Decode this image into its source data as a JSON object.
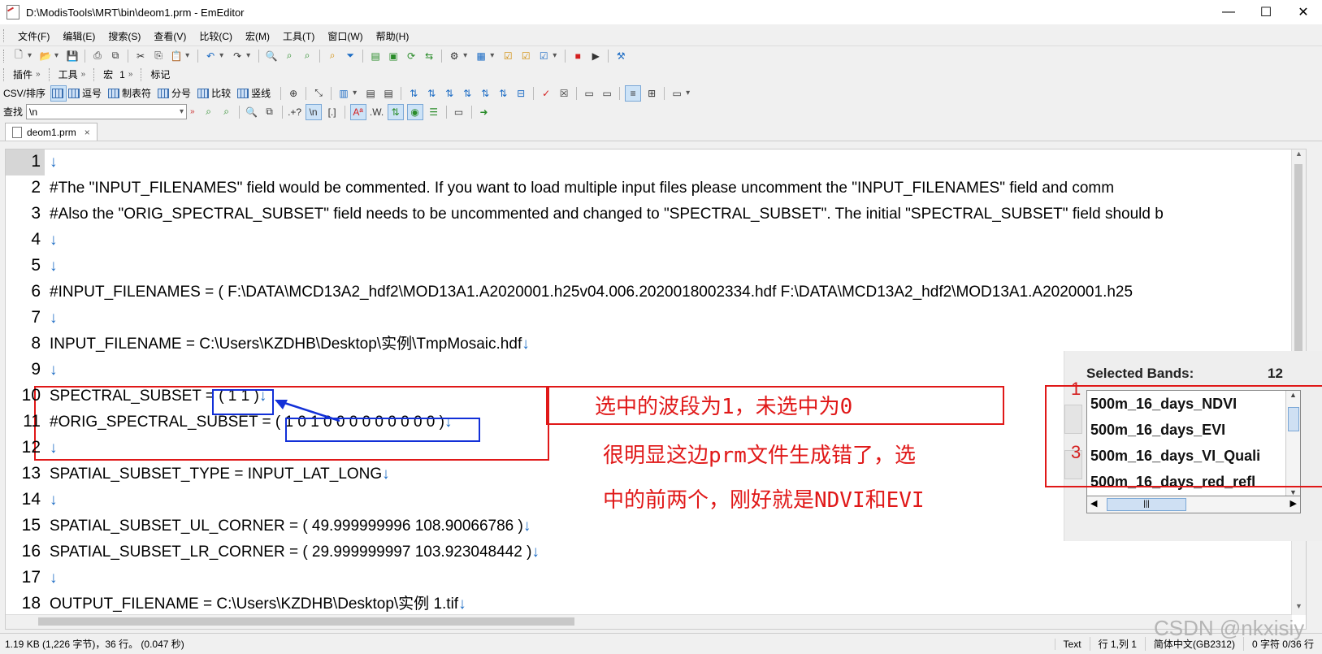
{
  "window": {
    "title": "D:\\ModisTools\\MRT\\bin\\deom1.prm - EmEditor",
    "minimize": "—",
    "maximize": "☐",
    "close": "✕"
  },
  "menu": [
    "文件(F)",
    "编辑(E)",
    "搜索(S)",
    "查看(V)",
    "比较(C)",
    "宏(M)",
    "工具(T)",
    "窗口(W)",
    "帮助(H)"
  ],
  "bars": {
    "plugins": "插件",
    "tools": "工具",
    "macro": "宏",
    "macro_num": "1",
    "marks": "标记"
  },
  "csv": {
    "label": "CSV/排序",
    "items": [
      "逗号",
      "制表符",
      "分号",
      "比较",
      "竖线"
    ]
  },
  "find": {
    "label": "查找",
    "value": "\\n",
    "regex": "\\n",
    "bracket": "[.]"
  },
  "tab": {
    "label": "deom1.prm"
  },
  "editor": {
    "lines": [
      {
        "n": "1",
        "text": "",
        "eol": "↓"
      },
      {
        "n": "2",
        "text": "#The \"INPUT_FILENAMES\" field would be commented. If you want to load multiple input files please uncomment the \"INPUT_FILENAMES\" field and comm",
        "eol": ""
      },
      {
        "n": "3",
        "text": "#Also the \"ORIG_SPECTRAL_SUBSET\" field needs to be uncommented and changed to \"SPECTRAL_SUBSET\". The initial \"SPECTRAL_SUBSET\" field should b",
        "eol": ""
      },
      {
        "n": "4",
        "text": "",
        "eol": "↓"
      },
      {
        "n": "5",
        "text": "",
        "eol": "↓"
      },
      {
        "n": "6",
        "text": "#INPUT_FILENAMES = ( F:\\DATA\\MCD13A2_hdf2\\MOD13A1.A2020001.h25v04.006.2020018002334.hdf F:\\DATA\\MCD13A2_hdf2\\MOD13A1.A2020001.h25",
        "eol": ""
      },
      {
        "n": "7",
        "text": "",
        "eol": "↓"
      },
      {
        "n": "8",
        "text": "INPUT_FILENAME = C:\\Users\\KZDHB\\Desktop\\实例\\TmpMosaic.hdf",
        "eol": "↓"
      },
      {
        "n": "9",
        "text": "",
        "eol": "↓"
      },
      {
        "n": "10",
        "text": "SPECTRAL_SUBSET = ( 1 1 )",
        "eol": "↓"
      },
      {
        "n": "11",
        "text": "#ORIG_SPECTRAL_SUBSET = ( 1 0 1 0 0 0 0 0 0 0 0 0 )",
        "eol": "↓"
      },
      {
        "n": "12",
        "text": "",
        "eol": "↓"
      },
      {
        "n": "13",
        "text": "SPATIAL_SUBSET_TYPE = INPUT_LAT_LONG",
        "eol": "↓"
      },
      {
        "n": "14",
        "text": "",
        "eol": "↓"
      },
      {
        "n": "15",
        "text": "SPATIAL_SUBSET_UL_CORNER = ( 49.999999996 108.90066786 )",
        "eol": "↓"
      },
      {
        "n": "16",
        "text": "SPATIAL_SUBSET_LR_CORNER = ( 29.999999997 103.923048442 )",
        "eol": "↓"
      },
      {
        "n": "17",
        "text": "",
        "eol": "↓"
      },
      {
        "n": "18",
        "text": "OUTPUT_FILENAME = C:\\Users\\KZDHB\\Desktop\\实例 1.tif",
        "eol": "↓"
      }
    ]
  },
  "panel": {
    "header": "Selected Bands:",
    "count": "12",
    "bands": [
      "500m_16_days_NDVI",
      "500m_16_days_EVI",
      "500m_16_days_VI_Quali",
      "500m_16_days_red_refl"
    ],
    "marker1": "1",
    "marker3": "3",
    "scroll_grip": "|||"
  },
  "annotations": {
    "a1": "选中的波段为1，未选中为0",
    "a2": "很明显这边prm文件生成错了，选",
    "a3": "中的前两个，刚好就是NDVI和EVI"
  },
  "status": {
    "left": "1.19 KB (1,226 字节)，36 行。 (0.047 秒)",
    "mode": "Text",
    "pos": "行 1,列 1",
    "enc": "简体中文(GB2312)",
    "right": "0 字符 0/36 行"
  },
  "watermark": "CSDN @nkxisiy"
}
